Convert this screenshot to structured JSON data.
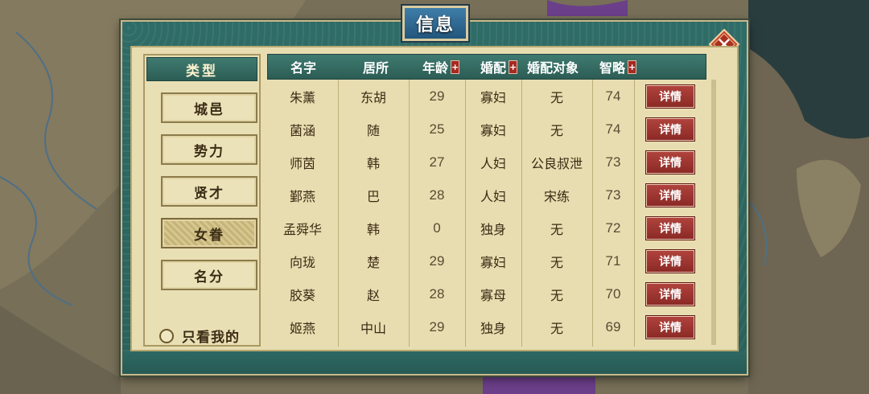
{
  "dialog": {
    "title": "信息"
  },
  "icons": {
    "close": "close-x-icon"
  },
  "types": {
    "header": "类型",
    "items": [
      {
        "label": "城邑"
      },
      {
        "label": "势力"
      },
      {
        "label": "贤才"
      },
      {
        "label": "女眷"
      },
      {
        "label": "名分"
      }
    ],
    "selected": "女眷",
    "only_mine_label": "只看我的"
  },
  "table": {
    "columns": [
      {
        "label": "名字"
      },
      {
        "label": "居所"
      },
      {
        "label": "年龄",
        "sort": "+"
      },
      {
        "label": "婚配",
        "sort": "+"
      },
      {
        "label": "婚配对象"
      },
      {
        "label": "智略",
        "sort": "+"
      }
    ],
    "detail_label": "详情",
    "rows": [
      {
        "name": "朱薰",
        "residence": "东胡",
        "age": "29",
        "marriage": "寡妇",
        "spouse": "无",
        "intellect": "74"
      },
      {
        "name": "菌涵",
        "residence": "随",
        "age": "25",
        "marriage": "寡妇",
        "spouse": "无",
        "intellect": "74"
      },
      {
        "name": "师茵",
        "residence": "韩",
        "age": "27",
        "marriage": "人妇",
        "spouse": "公良叔泄",
        "intellect": "73"
      },
      {
        "name": "鄞燕",
        "residence": "巴",
        "age": "28",
        "marriage": "人妇",
        "spouse": "宋练",
        "intellect": "73"
      },
      {
        "name": "孟舜华",
        "residence": "韩",
        "age": "0",
        "marriage": "独身",
        "spouse": "无",
        "intellect": "72"
      },
      {
        "name": "向珑",
        "residence": "楚",
        "age": "29",
        "marriage": "寡妇",
        "spouse": "无",
        "intellect": "71"
      },
      {
        "name": "胶葵",
        "residence": "赵",
        "age": "28",
        "marriage": "寡母",
        "spouse": "无",
        "intellect": "70"
      },
      {
        "name": "姬燕",
        "residence": "中山",
        "age": "29",
        "marriage": "独身",
        "spouse": "无",
        "intellect": "69"
      }
    ]
  },
  "colors": {
    "frame": "#2f6c67",
    "panel": "#e8ddb0",
    "detail_button": "#9b3530",
    "title_tab": "#2f6a95"
  }
}
